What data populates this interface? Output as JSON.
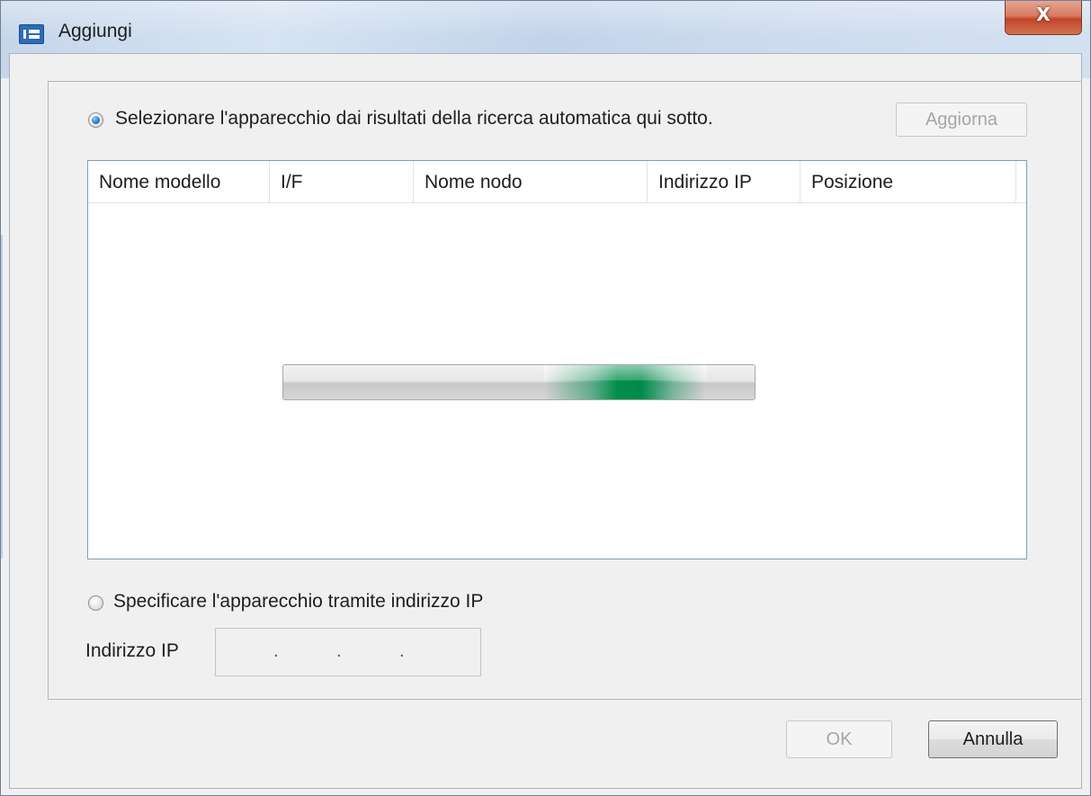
{
  "window": {
    "title": "Aggiungi",
    "close_label": "X"
  },
  "auto_search": {
    "label": "Selezionare l'apparecchio dai risultati della ricerca automatica qui sotto.",
    "selected": true,
    "refresh_label": "Aggiorna",
    "refresh_enabled": false
  },
  "device_table": {
    "columns": [
      "Nome modello",
      "I/F",
      "Nome nodo",
      "Indirizzo IP",
      "Posizione"
    ],
    "rows": [],
    "searching": true
  },
  "ip_option": {
    "label": "Specificare l'apparecchio tramite indirizzo IP",
    "selected": false,
    "field_label": "Indirizzo IP",
    "ip_separators": [
      ".",
      ".",
      "."
    ]
  },
  "footer": {
    "ok_label": "OK",
    "ok_enabled": false,
    "cancel_label": "Annulla"
  },
  "colors": {
    "progress_accent": "#008f4c",
    "title_bar": "#c6d6ea",
    "close_button": "#c2452a",
    "radio_checked": "#2f7fd0"
  },
  "icons": [
    "app-window-icon",
    "close-icon",
    "radio-icon"
  ]
}
